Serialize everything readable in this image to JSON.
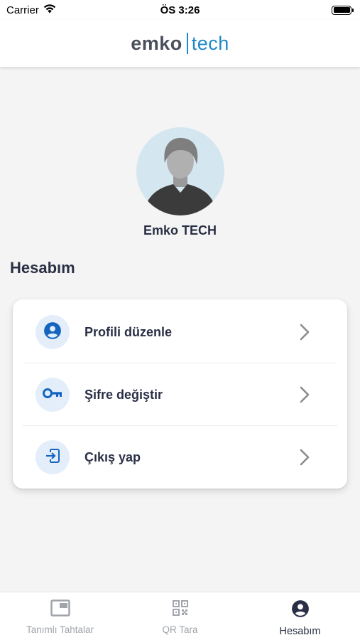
{
  "status_bar": {
    "carrier": "Carrier",
    "time": "ÖS 3:26"
  },
  "header": {
    "logo_left": "emko",
    "logo_right": "tech"
  },
  "profile": {
    "name": "Emko TECH"
  },
  "section": {
    "title": "Hesabım"
  },
  "menu": {
    "items": [
      {
        "label": "Profili düzenle",
        "icon": "person-circle-icon"
      },
      {
        "label": "Şifre değiştir",
        "icon": "key-icon"
      },
      {
        "label": "Çıkış yap",
        "icon": "logout-icon"
      }
    ]
  },
  "bottom_nav": {
    "items": [
      {
        "label": "Tanımlı Tahtalar",
        "icon": "board-icon",
        "active": false
      },
      {
        "label": "QR Tara",
        "icon": "qr-code-icon",
        "active": false
      },
      {
        "label": "Hesabım",
        "icon": "account-icon",
        "active": true
      }
    ]
  },
  "colors": {
    "accent": "#1e88c8",
    "icon_blue": "#1565c0",
    "icon_bg": "#e4eefb",
    "text_dark": "#2a2f45",
    "nav_inactive": "#a0a4ab"
  }
}
